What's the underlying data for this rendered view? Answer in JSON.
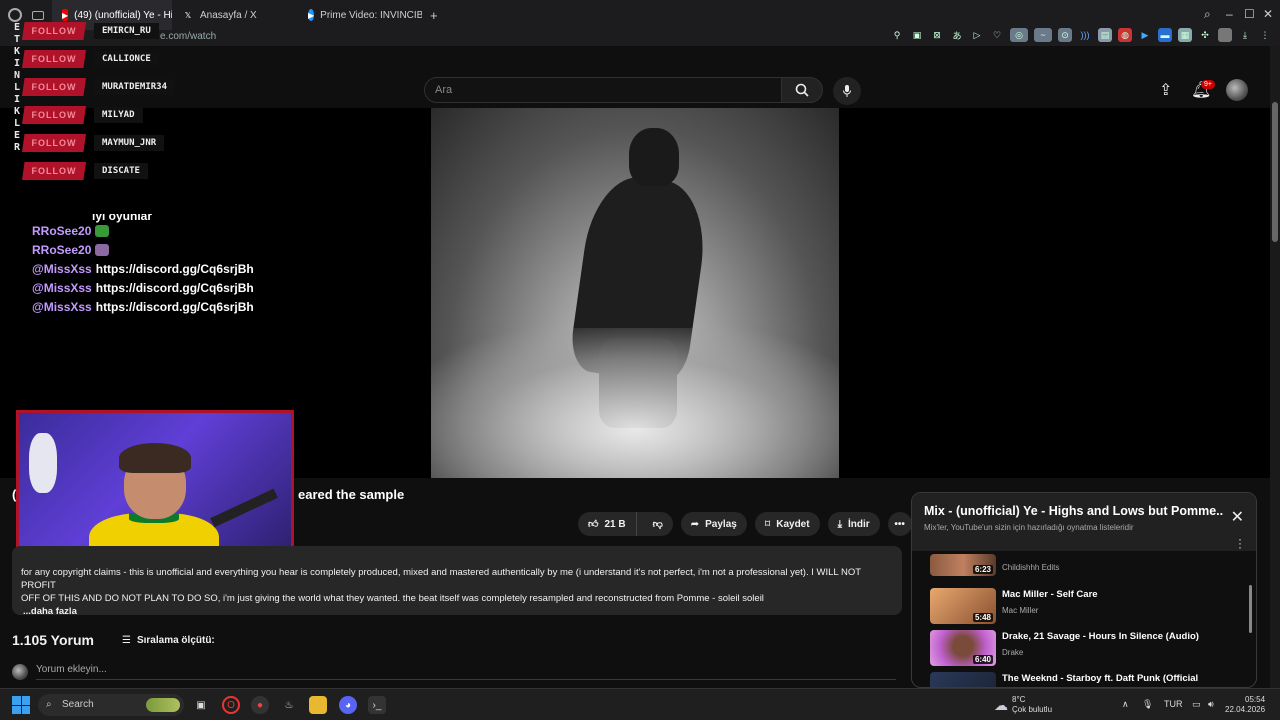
{
  "browser": {
    "tabs": [
      {
        "label": "(49) (unofficial) Ye - Highs",
        "active": true,
        "favicon": "youtube-icon"
      },
      {
        "label": "Anasayfa / X",
        "active": false,
        "favicon": "x-icon"
      },
      {
        "label": "Prime Video: INVINCIBLE",
        "active": false,
        "favicon": "prime-icon"
      }
    ],
    "new_tab": "+",
    "url": "e.com/watch"
  },
  "youtube": {
    "search_placeholder": "Ara",
    "notification_count": "9+"
  },
  "overlay": {
    "vertical_label": "ETKINLIKLER",
    "follow_label": "FOLLOW",
    "followers": [
      "EMIRCN_RU",
      "CALLIONCE",
      "MURATDEMIR34",
      "MILYAD",
      "MAYMUN_JNR",
      "DISCATE"
    ],
    "chat_partial": "iyi oyunlar",
    "chat": [
      {
        "user": "RRoSee20",
        "msg": ""
      },
      {
        "user": "RRoSee20",
        "msg": ""
      },
      {
        "user": "@MissXss",
        "msg": "https://discord.gg/Cq6srjBh"
      },
      {
        "user": "@MissXss",
        "msg": "https://discord.gg/Cq6srjBh"
      },
      {
        "user": "@MissXss",
        "msg": "https://discord.gg/Cq6srjBh"
      }
    ]
  },
  "video": {
    "title_lead": "(",
    "title_tail": "eared the sample",
    "likes": "21 B",
    "share": "Paylaş",
    "save": "Kaydet",
    "download": "İndir",
    "description_line1": "for any copyright claims - this is unofficial and everything you hear is completely produced, mixed and mastered authentically by me (i understand it's not perfect, i'm not a professional yet). I WILL NOT PROFIT",
    "description_line2": "OFF OF THIS AND DO NOT PLAN TO DO SO, i'm just giving the world what they wanted. the beat itself was completely resampled and reconstructed from Pomme - soleil soleil",
    "more": "...daha fazla"
  },
  "comments": {
    "count": "1.105 Yorum",
    "sort": "Sıralama ölçütü:",
    "placeholder": "Yorum ekleyin..."
  },
  "mix": {
    "title": "Mix - (unofficial) Ye - Highs and Lows but Pomme...",
    "subtitle": "Mix'ler, YouTube'un sizin için hazırladığı oynatma listeleridir",
    "items": [
      {
        "title": "",
        "channel": "Childishhh Edits",
        "duration": "6:23",
        "color": "#8a5a40"
      },
      {
        "title": "Mac Miller - Self Care",
        "channel": "Mac Miller",
        "duration": "5:48",
        "color": "#b07a50"
      },
      {
        "title": "Drake, 21 Savage - Hours In Silence (Audio)",
        "channel": "Drake",
        "duration": "6:40",
        "color": "#c060c0"
      },
      {
        "title": "The Weeknd - Starboy ft. Daft Punk (Official",
        "channel": "",
        "duration": "",
        "color": "#2a3a5a"
      }
    ]
  },
  "taskbar": {
    "search": "Search",
    "weather_temp": "8°C",
    "weather_desc": "Çok bulutlu",
    "lang": "TUR",
    "time": "05:54",
    "date": "22.04.2026"
  }
}
